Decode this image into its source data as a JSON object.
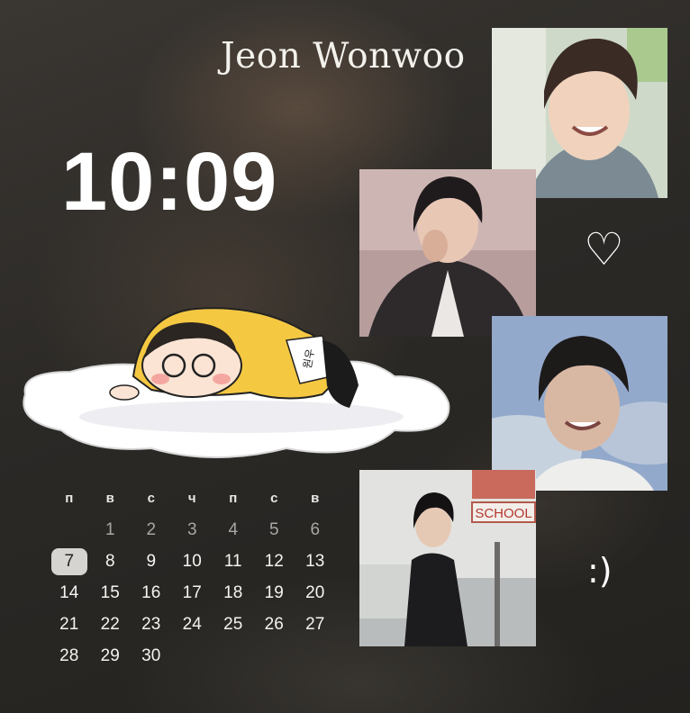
{
  "widgets": {
    "title": "Jeon Wonwoo",
    "clock": "10:09",
    "heart": "♡",
    "smile": ":)"
  },
  "photos": [
    {
      "subject": "smiling-portrait-photo"
    },
    {
      "subject": "stage-portrait-photo"
    },
    {
      "subject": "sky-portrait-photo"
    },
    {
      "subject": "street-portrait-photo",
      "sign_text": "SCHOOL"
    }
  ],
  "sticker": {
    "badge_text": "원우"
  },
  "calendar": {
    "weekdays": [
      "п",
      "в",
      "с",
      "ч",
      "п",
      "с",
      "в"
    ],
    "weeks": [
      [
        "",
        "1",
        "2",
        "3",
        "4",
        "5",
        "6"
      ],
      [
        "7",
        "8",
        "9",
        "10",
        "11",
        "12",
        "13"
      ],
      [
        "14",
        "15",
        "16",
        "17",
        "18",
        "19",
        "20"
      ],
      [
        "21",
        "22",
        "23",
        "24",
        "25",
        "26",
        "27"
      ],
      [
        "28",
        "29",
        "30",
        "",
        "",
        "",
        ""
      ]
    ],
    "today": "7"
  },
  "colors": {
    "text": "#ffffff",
    "today_bg": "#d6d4d0",
    "dim": "#a9a7a3",
    "sticker_yellow": "#f5c842"
  }
}
